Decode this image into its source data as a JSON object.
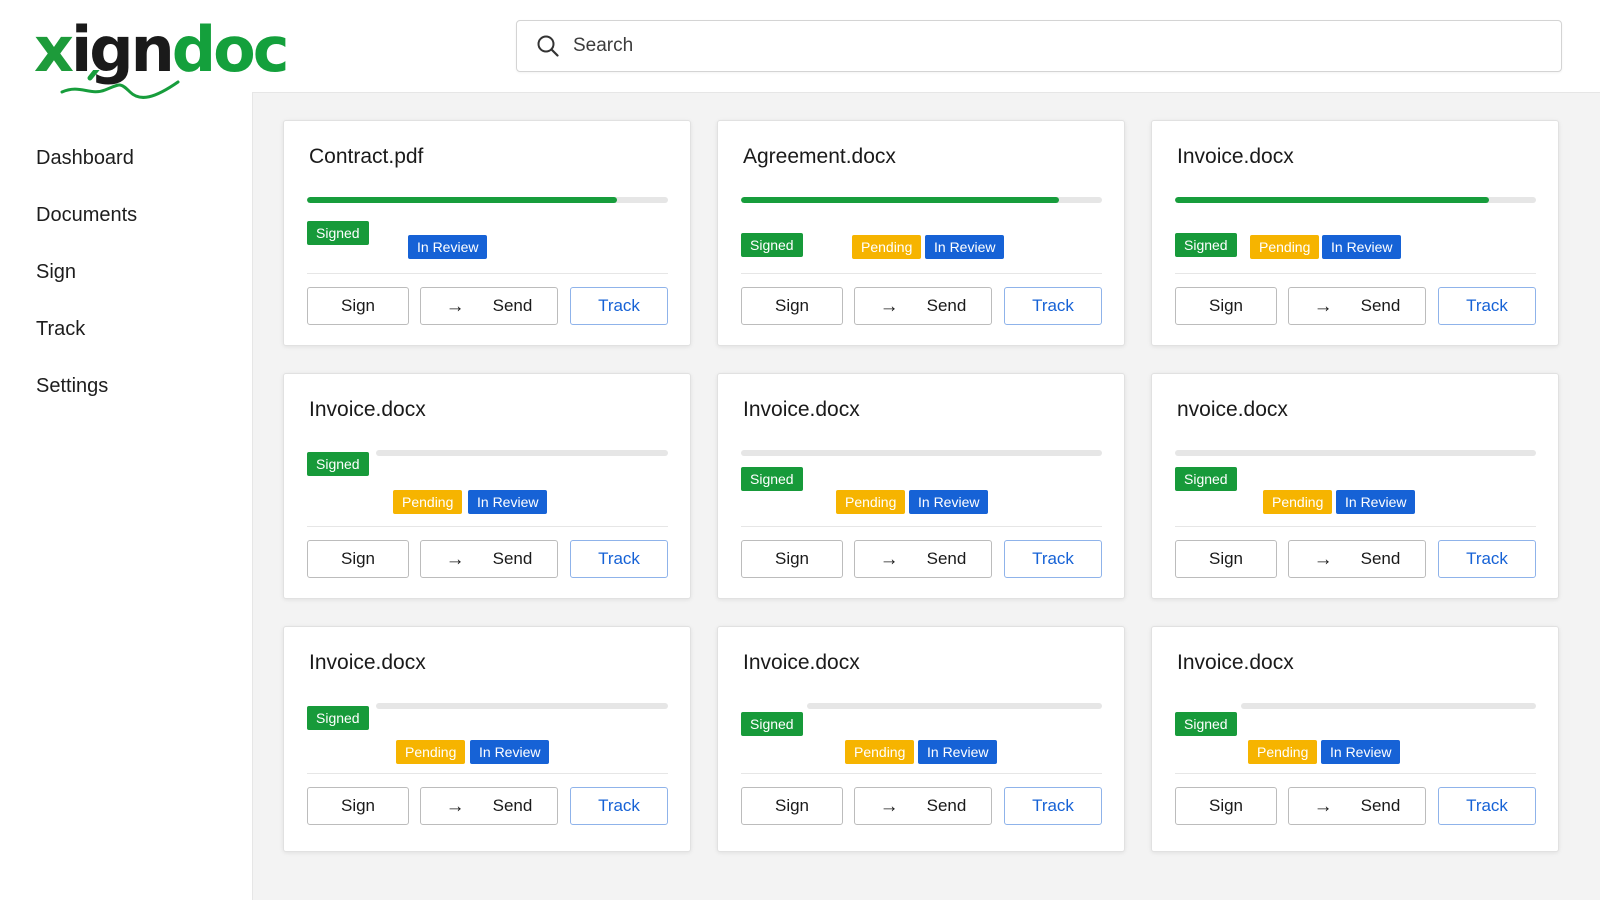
{
  "app": {
    "logo": {
      "text": "xigndoc",
      "brand_color": "#14a03c"
    }
  },
  "search": {
    "placeholder": "Search",
    "value": ""
  },
  "sidebar": {
    "items": [
      {
        "label": "Dashboard"
      },
      {
        "label": "Documents"
      },
      {
        "label": "Sign"
      },
      {
        "label": "Track"
      },
      {
        "label": "Settings"
      }
    ]
  },
  "colors": {
    "signed": "#179a3a",
    "pending": "#f6b400",
    "in_review": "#1662d6",
    "progress": "#179d3c",
    "track_text": "#1662d6"
  },
  "documents": [
    {
      "name": "Contract.pdf",
      "progress": 0.86,
      "badges": [
        "Signed",
        "In Review"
      ]
    },
    {
      "name": "Agreement.docx",
      "progress": 0.88,
      "badges": [
        "Signed",
        "Pending",
        "In Review"
      ]
    },
    {
      "name": "Invoice.docx",
      "progress": 0.87,
      "badges": [
        "Signed",
        "Pending",
        "In Review"
      ]
    },
    {
      "name": "Invoice.docx",
      "progress": 0,
      "badges": [
        "Signed",
        "Pending",
        "In Review"
      ]
    },
    {
      "name": "Invoice.docx",
      "progress": 0,
      "badges": [
        "Signed",
        "Pending",
        "In Review"
      ]
    },
    {
      "name": "nvoice.docx",
      "progress": 0,
      "badges": [
        "Signed",
        "Pending",
        "In Review"
      ]
    },
    {
      "name": "Invoice.docx",
      "progress": 0,
      "badges": [
        "Signed",
        "Pending",
        "In Review"
      ]
    },
    {
      "name": "Invoice.docx",
      "progress": 0,
      "badges": [
        "Signed",
        "Pending",
        "In Review"
      ]
    },
    {
      "name": "Invoice.docx",
      "progress": 0,
      "badges": [
        "Signed",
        "Pending",
        "In Review"
      ]
    }
  ],
  "actions": {
    "sign": "Sign",
    "send": "Send",
    "track": "Track",
    "send_icon": "arrow-right-icon"
  }
}
